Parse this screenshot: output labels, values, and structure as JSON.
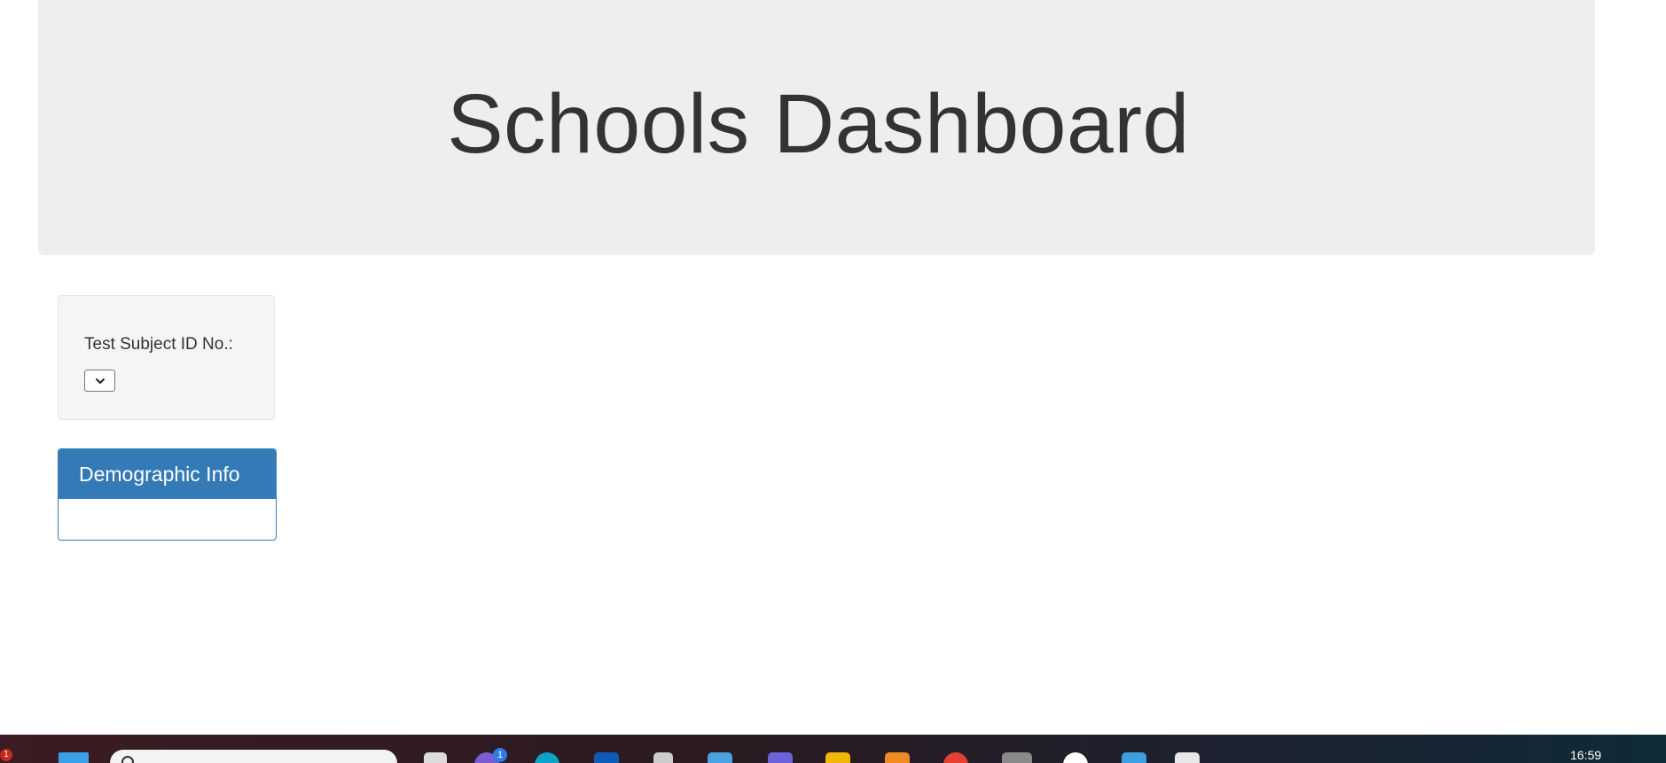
{
  "header": {
    "title": "Schools Dashboard"
  },
  "controls": {
    "subject_label": "Test Subject ID No.:",
    "subject_selected": ""
  },
  "panels": {
    "demographic_title": "Demographic Info"
  },
  "taskbar": {
    "time": "16:59",
    "notification_count": "1",
    "app_badge_count": "1",
    "icons": [
      "windows-start-icon",
      "search-icon",
      "teams-icon",
      "edge-icon",
      "outlook-icon",
      "app-icon",
      "store-icon",
      "copilot-icon",
      "file-explorer-icon",
      "photos-icon",
      "chrome-icon",
      "app-icon",
      "slack-icon",
      "calendar-icon",
      "dashboard-app-icon"
    ],
    "colors": {
      "accent": "#337ab7",
      "jumbotron": "#eeeeee"
    }
  }
}
